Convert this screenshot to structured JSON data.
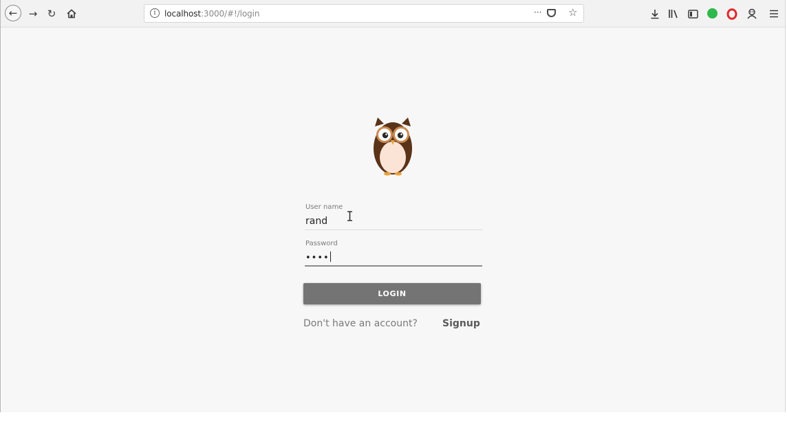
{
  "browser": {
    "url_host": "localhost",
    "url_rest": ":3000/#!/login",
    "url_more": "···"
  },
  "login": {
    "username_label": "User name",
    "username_value": "rand",
    "password_label": "Password",
    "password_value": "••••",
    "login_button": "LOGIN",
    "no_account_text": "Don't have an account?",
    "signup_link": "Signup"
  },
  "colors": {
    "button_bg": "#747474",
    "page_bg": "#f8f7f8",
    "owl_brown": "#5a3318",
    "owl_belly": "#fbe3d6",
    "ext_green": "#2fb84c",
    "ext_red": "#e3262c"
  },
  "icons": [
    "back-icon",
    "forward-icon",
    "reload-icon",
    "home-icon",
    "info-icon",
    "page-actions-icon",
    "pocket-icon",
    "bookmark-star-icon",
    "download-icon",
    "library-icon",
    "sidebar-icon",
    "grammarly-icon",
    "opera-icon",
    "incognito-icon",
    "menu-icon"
  ]
}
